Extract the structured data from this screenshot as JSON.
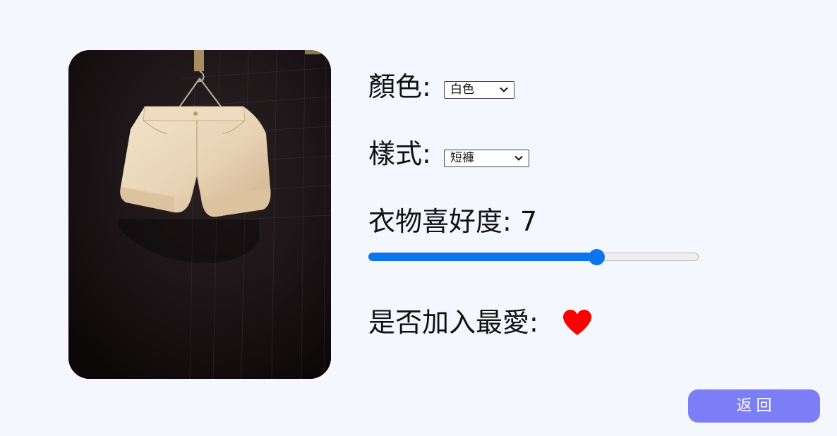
{
  "item": {
    "photo_alt": "cream denim shorts on a hanger"
  },
  "form": {
    "color": {
      "label": "顏色:",
      "value": "白色"
    },
    "style": {
      "label": "樣式:",
      "value": "短褲"
    },
    "preference": {
      "label": "衣物喜好度:",
      "value": 7,
      "max": 10
    },
    "favorite": {
      "label": "是否加入最愛:",
      "icon": "heart-icon",
      "checked": true
    }
  },
  "actions": {
    "back_label": "返回"
  },
  "colors": {
    "background": "#f4f7fd",
    "accent": "#0a75ef",
    "heart": "#ff0000",
    "button": "#7b7ef7"
  }
}
